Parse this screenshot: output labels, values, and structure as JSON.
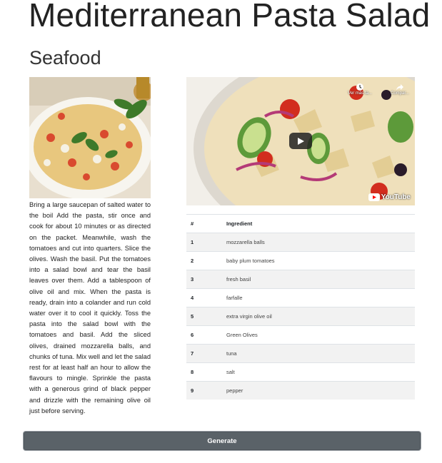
{
  "recipe": {
    "title": "Mediterranean Pasta Salad",
    "category": "Seafood",
    "instructions": "Bring a large saucepan of salted water to the boil Add the pasta, stir once and cook for about 10 minutes or as directed on the packet. Meanwhile, wash the tomatoes and cut into quarters. Slice the olives. Wash the basil. Put the tomatoes into a salad bowl and tear the basil leaves over them. Add a tablespoon of olive oil and mix. When the pasta is ready, drain into a colander and run cold water over it to cool it quickly. Toss the pasta into the salad bowl with the tomatoes and basil. Add the sliced olives, drained mozzarella balls, and chunks of tuna. Mix well and let the salad rest for at least half an hour to allow the flavours to mingle. Sprinkle the pasta with a generous grind of black pepper and drizzle with the remaining olive oil just before serving."
  },
  "video": {
    "watch_later": "Ver más ta...",
    "share": "Compar...",
    "logo_text": "YouTube",
    "icons": {
      "play": "play-icon",
      "clock": "clock-icon",
      "share": "share-icon"
    }
  },
  "ingredients_table": {
    "headers": {
      "num": "#",
      "name": "Ingredient"
    },
    "rows": [
      {
        "num": "1",
        "name": "mozzarella balls"
      },
      {
        "num": "2",
        "name": "baby plum tomatoes"
      },
      {
        "num": "3",
        "name": "fresh basil"
      },
      {
        "num": "4",
        "name": "farfalle"
      },
      {
        "num": "5",
        "name": "extra virgin olive oil"
      },
      {
        "num": "6",
        "name": "Green Olives"
      },
      {
        "num": "7",
        "name": "tuna"
      },
      {
        "num": "8",
        "name": "salt"
      },
      {
        "num": "9",
        "name": "pepper"
      }
    ]
  },
  "actions": {
    "generate_label": "Generate"
  },
  "colors": {
    "button_bg": "#5a6268",
    "stripe": "#f2f2f2",
    "border": "#dee2e6"
  }
}
